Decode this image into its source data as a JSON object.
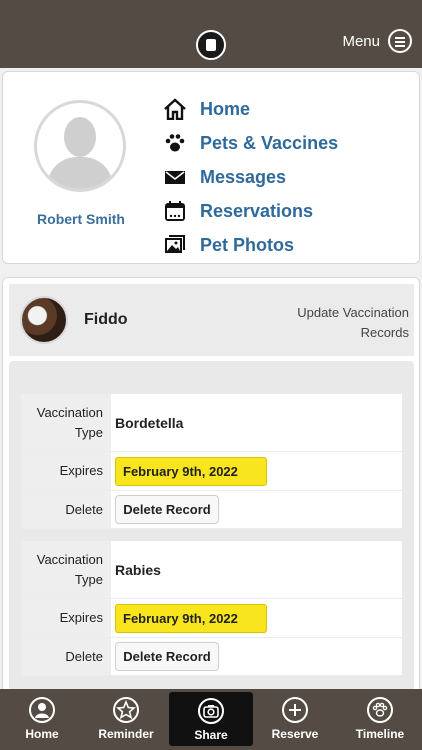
{
  "header": {
    "menu_label": "Menu"
  },
  "profile": {
    "name": "Robert Smith",
    "nav": [
      {
        "label": "Home",
        "icon": "home-icon"
      },
      {
        "label": "Pets & Vaccines",
        "icon": "paw-icon"
      },
      {
        "label": "Messages",
        "icon": "envelope-icon"
      },
      {
        "label": "Reservations",
        "icon": "calendar-icon"
      },
      {
        "label": "Pet Photos",
        "icon": "photos-icon"
      }
    ]
  },
  "pet": {
    "name": "Fiddo",
    "update_link": "Update Vaccination Records"
  },
  "labels": {
    "type": "Vaccination Type",
    "expires": "Expires",
    "delete": "Delete",
    "delete_button": "Delete Record"
  },
  "records": [
    {
      "type": "Bordetella",
      "expires": "February 9th, 2022"
    },
    {
      "type": "Rabies",
      "expires": "February 9th, 2022"
    }
  ],
  "bottom_nav": [
    {
      "label": "Home",
      "icon": "person-icon"
    },
    {
      "label": "Reminder",
      "icon": "star-icon"
    },
    {
      "label": "Share",
      "icon": "camera-icon",
      "active": true
    },
    {
      "label": "Reserve",
      "icon": "plus-icon"
    },
    {
      "label": "Timeline",
      "icon": "paw-icon"
    }
  ],
  "colors": {
    "bar": "#544c44",
    "link": "#2f6a9c",
    "date_highlight": "#f9e51d"
  }
}
